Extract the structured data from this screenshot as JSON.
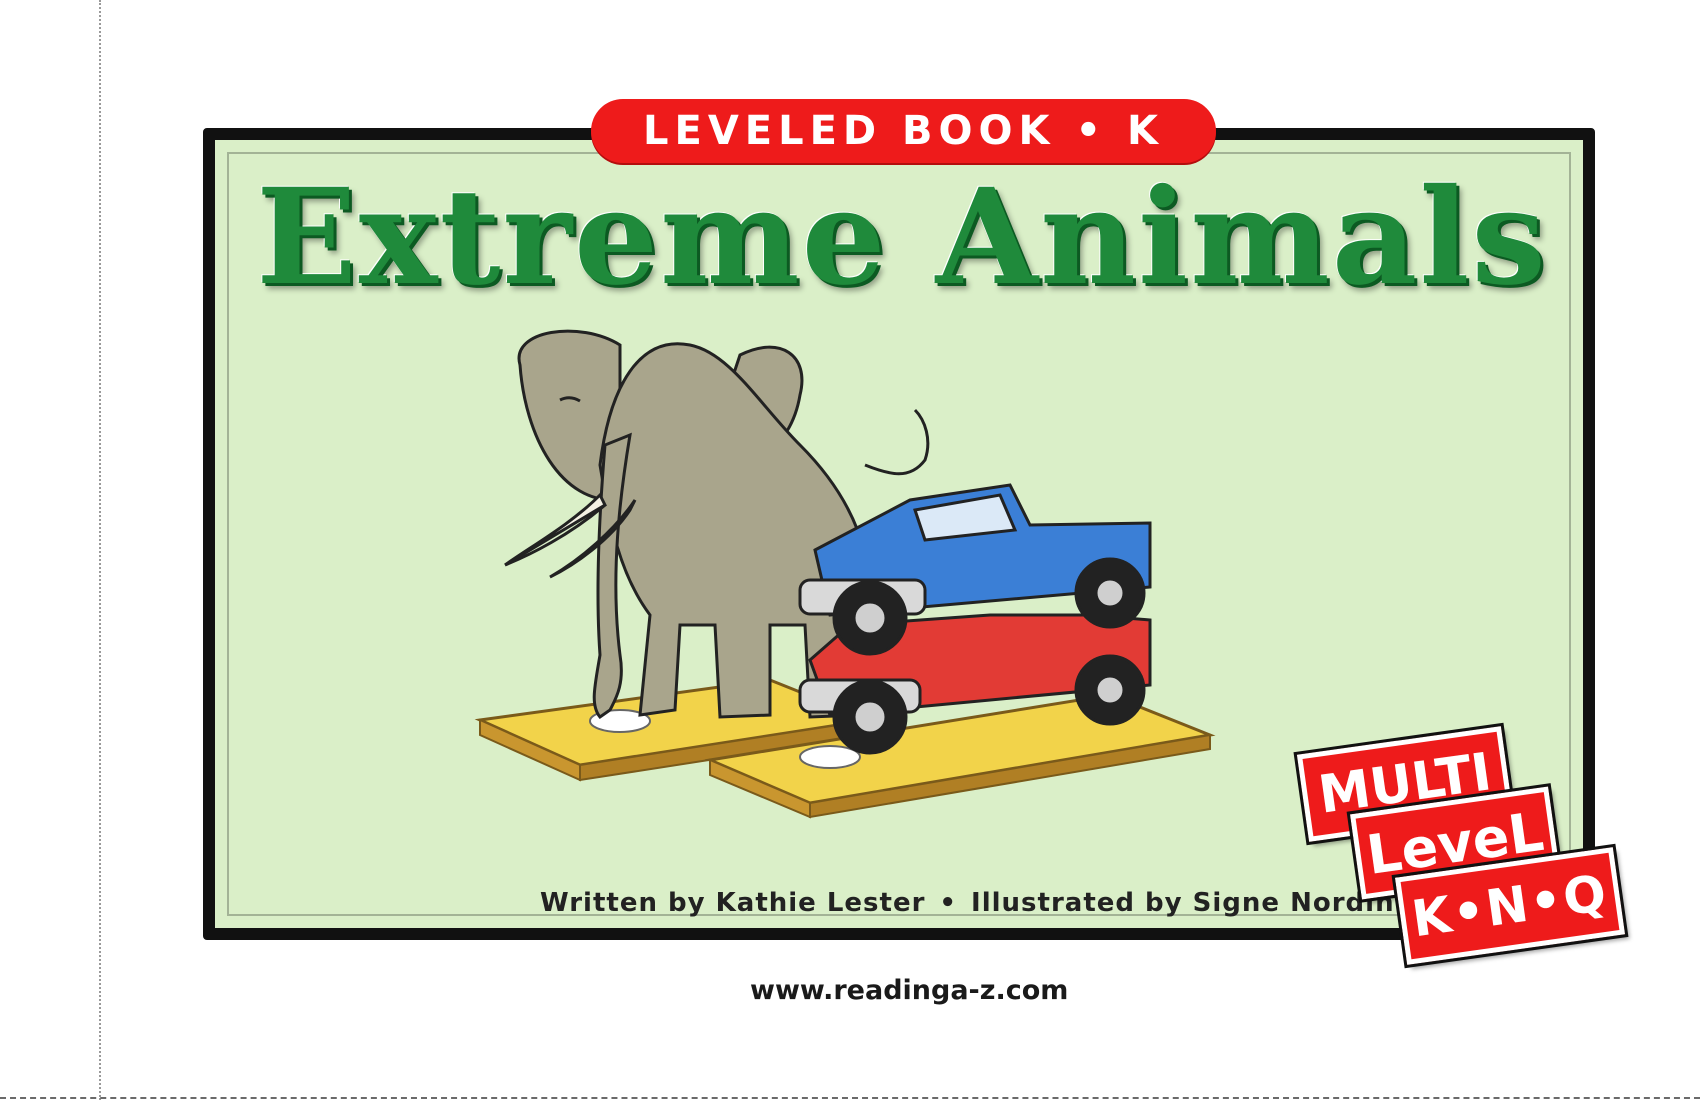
{
  "banner": {
    "label": "LEVELED BOOK • K"
  },
  "book": {
    "title": "Extreme Animals",
    "credits": {
      "written": "Written by Kathie Lester",
      "separator": "•",
      "illustrated": "Illustrated by Signe Nordin"
    },
    "url": "www.readinga-z.com"
  },
  "badge": {
    "line1": "MULTI",
    "line2": "LeveL",
    "line3": "K•N•Q"
  },
  "colors": {
    "banner_red": "#ee1b1b",
    "title_green": "#1f8a3b",
    "panel_green": "#daefc8",
    "frame_black": "#111111"
  },
  "illustration": {
    "subject": "elephant standing on a scale next to two stacked pickup trucks",
    "icons": [
      "elephant-illustration",
      "blue-pickup-truck",
      "red-pickup-truck",
      "scale-platform"
    ]
  }
}
